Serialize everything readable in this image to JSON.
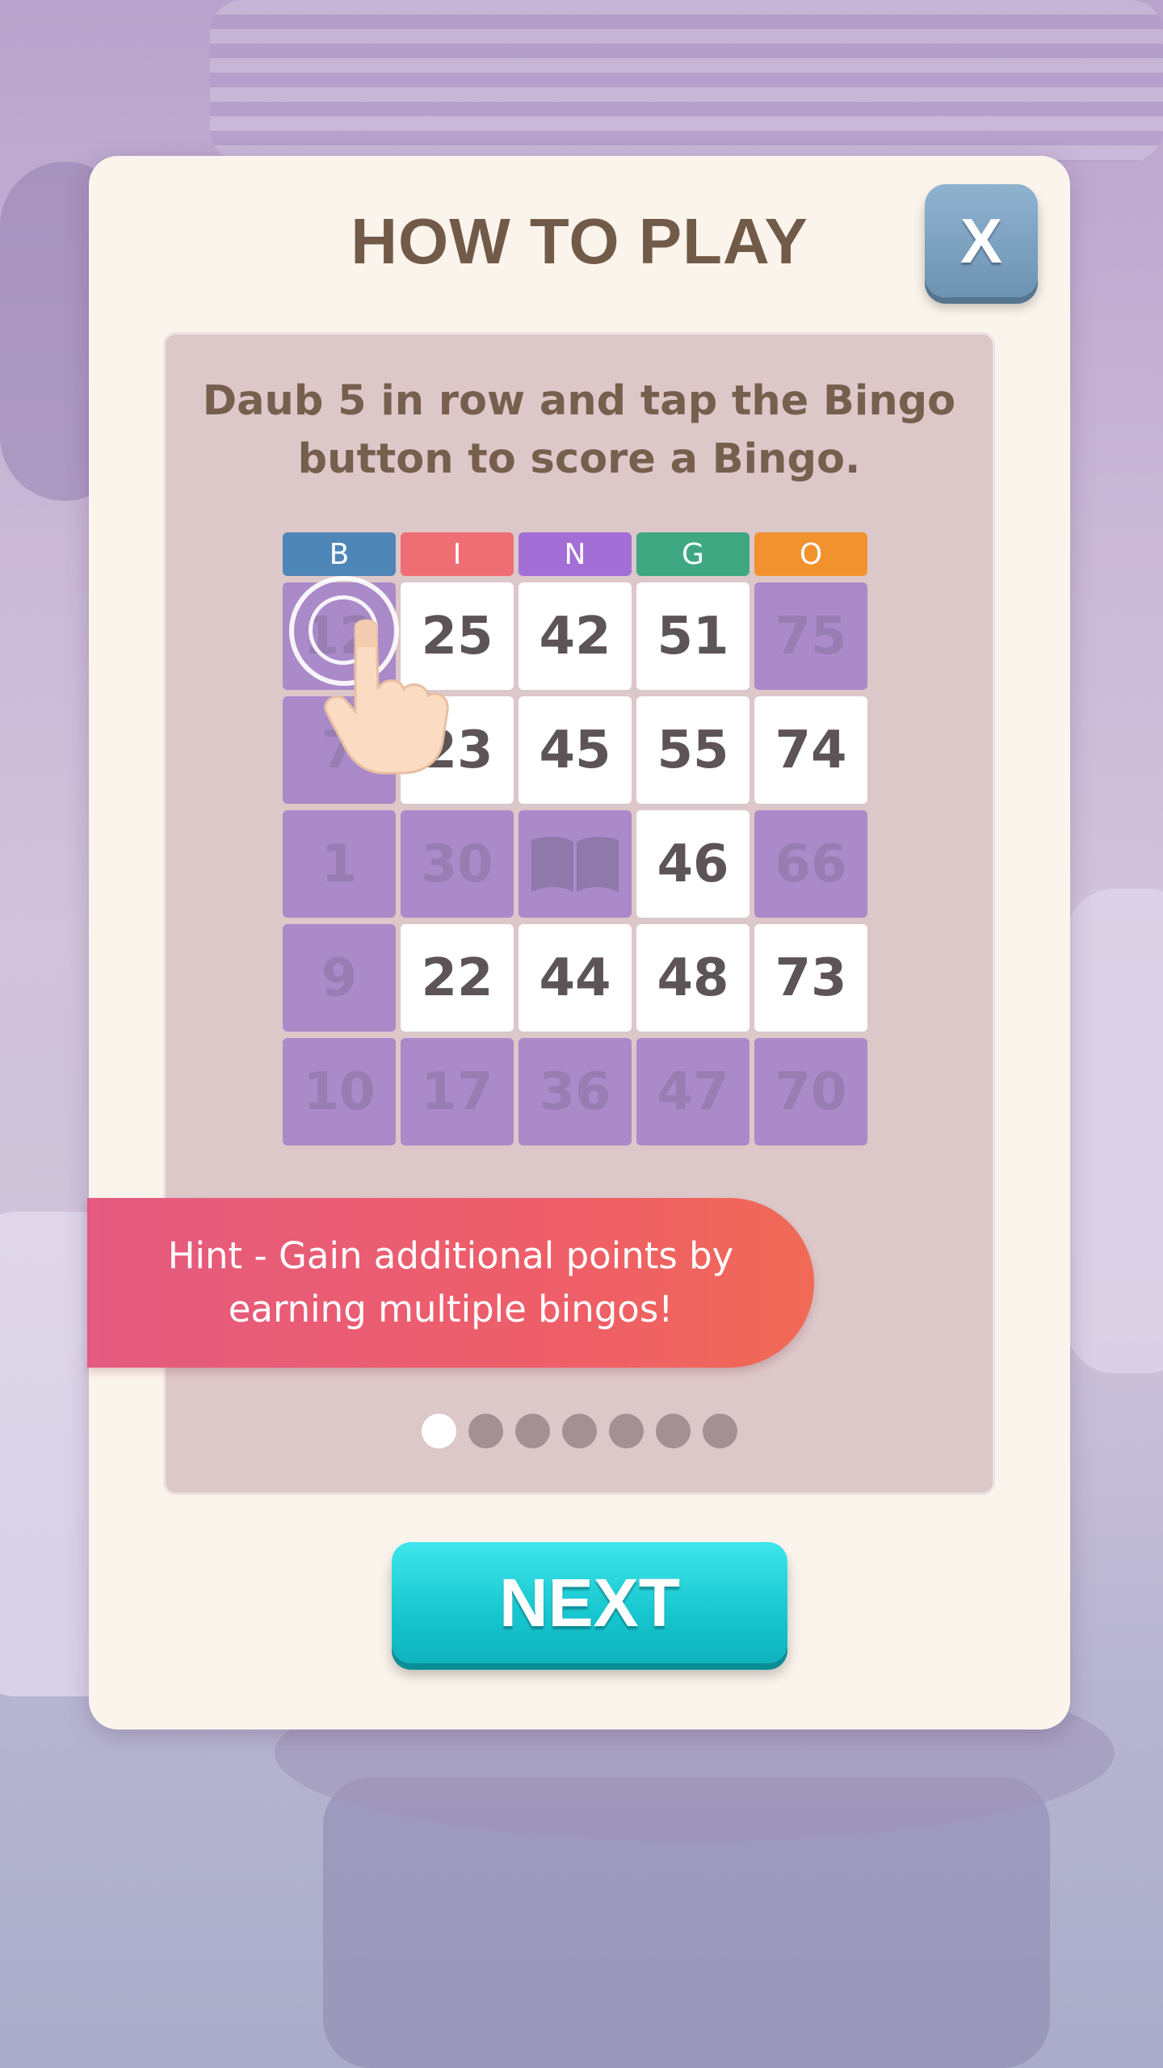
{
  "dialog": {
    "title": "HOW TO PLAY",
    "close_label": "X",
    "instruction": "Daub 5 in row and tap the Bingo button to score a Bingo.",
    "hint": "Hint - Gain additional points by earning multiple bingos!",
    "next_label": "NEXT"
  },
  "card": {
    "headers": [
      {
        "letter": "B",
        "color": "#4f86b8"
      },
      {
        "letter": "I",
        "color": "#ef6e73"
      },
      {
        "letter": "N",
        "color": "#a36fd6"
      },
      {
        "letter": "G",
        "color": "#3fa882"
      },
      {
        "letter": "O",
        "color": "#f1922e"
      }
    ],
    "rows": [
      [
        {
          "v": "12",
          "d": true
        },
        {
          "v": "25",
          "d": false
        },
        {
          "v": "42",
          "d": false
        },
        {
          "v": "51",
          "d": false
        },
        {
          "v": "75",
          "d": true
        }
      ],
      [
        {
          "v": "7",
          "d": true
        },
        {
          "v": "23",
          "d": false
        },
        {
          "v": "45",
          "d": false
        },
        {
          "v": "55",
          "d": false
        },
        {
          "v": "74",
          "d": false
        }
      ],
      [
        {
          "v": "1",
          "d": true
        },
        {
          "v": "30",
          "d": true
        },
        {
          "v": "",
          "d": true,
          "icon": "book-icon"
        },
        {
          "v": "46",
          "d": false
        },
        {
          "v": "66",
          "d": true
        }
      ],
      [
        {
          "v": "9",
          "d": true
        },
        {
          "v": "22",
          "d": false
        },
        {
          "v": "44",
          "d": false
        },
        {
          "v": "48",
          "d": false
        },
        {
          "v": "73",
          "d": false
        }
      ],
      [
        {
          "v": "10",
          "d": true
        },
        {
          "v": "17",
          "d": true
        },
        {
          "v": "36",
          "d": true
        },
        {
          "v": "47",
          "d": true
        },
        {
          "v": "70",
          "d": true
        }
      ]
    ]
  },
  "pagination": {
    "count": 7,
    "active_index": 0
  },
  "colors": {
    "title": "#725a49",
    "close_button": "#7a9dbd",
    "next_button": "#17c6cf",
    "hint_banner": "#ef5f66",
    "daubed_cell": "#aa8ac9",
    "panel": "#dcc7c9"
  }
}
